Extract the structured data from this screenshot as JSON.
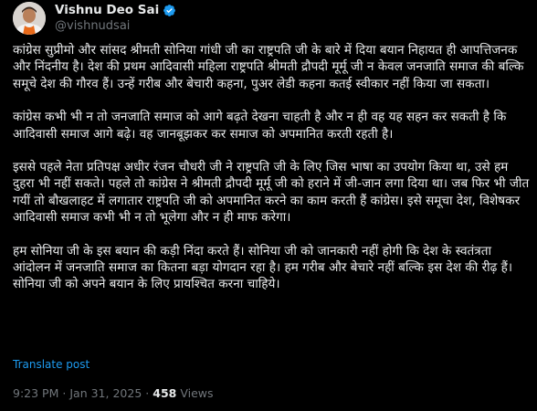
{
  "author": {
    "display_name": "Vishnu Deo Sai",
    "handle": "@vishnudsai",
    "verified_icon": "verified-badge",
    "verified_color": "#1d9bf0"
  },
  "post": {
    "paragraphs": [
      "कांग्रेस सुप्रीमो और सांसद श्रीमती सोनिया गांधी जी का राष्ट्रपति जी के बारे में दिया बयान निहायत ही आपत्तिजनक और निंदनीय है। देश की प्रथम आदिवासी महिला राष्ट्रपति श्रीमती द्रौपदी मूर्मू जी न केवल जनजाति समाज की बल्कि समूचे देश की गौरव हैं। उन्हें गरीब और बेचारी कहना, पुअर लेडी कहना कतई स्वीकार नहीं किया जा सकता।",
      "कांग्रेस कभी भी न तो जनजाति समाज को आगे बढ़ते देखना चाहती है और न ही वह यह सहन कर सकती है कि आदिवासी समाज आगे बढ़े। वह जानबूझकर कर समाज को अपमानित करती रहती है।",
      "इससे पहले नेता प्रतिपक्ष अधीर रंजन चौधरी जी ने राष्ट्रपति जी के लिए जिस भाषा का उपयोग किया था, उसे हम दुहरा भी नहीं सकते। पहले तो कांग्रेस ने श्रीमती द्रौपदी मूर्मू जी को हराने में जी-जान लगा दिया था। जब फिर भी जीत गयीं तो बौखलाहट में लगातार राष्ट्रपति जी को अपमानित करने का काम करती हैं कांग्रेस। इसे समूचा देश, विशेषकर आदिवासी समाज कभी भी न तो भूलेगा और न ही माफ करेगा।",
      "हम सोनिया जी के इस बयान की कड़ी निंदा करते हैं। सोनिया जी को जानकारी नहीं होगी कि देश के स्वतंत्रता आंदोलन में जनजाति समाज का कितना बड़ा योगदान रहा है। हम गरीब और बेचारे नहीं बल्कि इस देश की रीढ़ हैं। सोनिया जी को अपने बयान के लिए प्रायश्चित करना चाहिये।"
    ],
    "translate_label": "Translate post",
    "time": "9:23 PM",
    "separator": "·",
    "date": "Jan 31, 2025",
    "views_count": "458",
    "views_label": "Views"
  }
}
